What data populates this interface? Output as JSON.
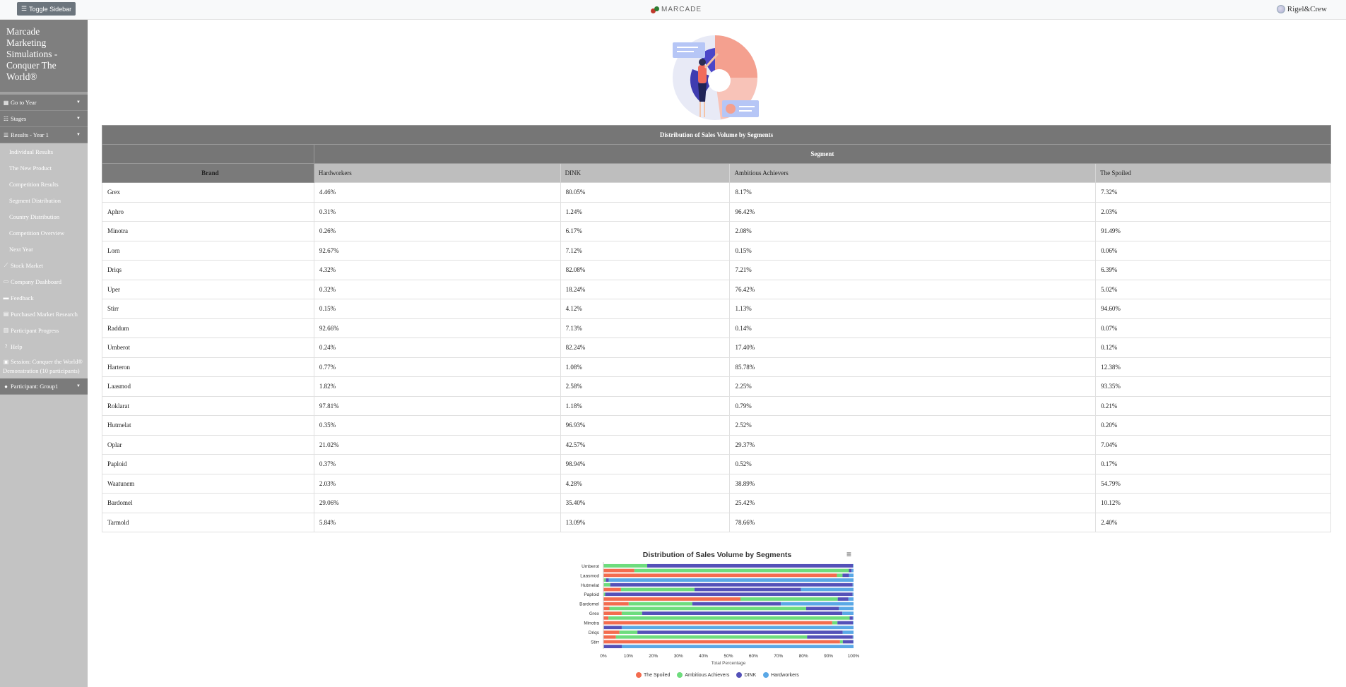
{
  "topbar": {
    "toggle_label": "Toggle Sidebar",
    "logo_text": "MARCADE",
    "company": "Rigel&Crew"
  },
  "sidebar": {
    "title": "Marcade Marketing Simulations - Conquer The World®",
    "go_to_year": "Go to Year",
    "stages": "Stages",
    "results": "Results - Year 1",
    "sub_items": [
      "Individual Results",
      "The New Product",
      "Competition Results",
      "Segment Distribution",
      "Country Distribution",
      "Competition Overview",
      "Next Year"
    ],
    "stock_market": "Stock Market",
    "company_dashboard": "Company Dashboard",
    "feedback": "Feedback",
    "purchased_research": "Purchased Market Research",
    "participant_progress": "Participant Progress",
    "help": "Help",
    "session": "Session: Conquer the World® Demonstration (10 participants)",
    "participant": "Participant: Group1"
  },
  "table": {
    "caption": "Distribution of Sales Volume by Segments",
    "segment_header": "Segment",
    "brand_header": "Brand",
    "columns": [
      "Hardworkers",
      "DINK",
      "Ambitious Achievers",
      "The Spoiled"
    ],
    "rows": [
      [
        "Grex",
        "4.46%",
        "80.05%",
        "8.17%",
        "7.32%"
      ],
      [
        "Aphro",
        "0.31%",
        "1.24%",
        "96.42%",
        "2.03%"
      ],
      [
        "Minotra",
        "0.26%",
        "6.17%",
        "2.08%",
        "91.49%"
      ],
      [
        "Lorn",
        "92.67%",
        "7.12%",
        "0.15%",
        "0.06%"
      ],
      [
        "Driqs",
        "4.32%",
        "82.08%",
        "7.21%",
        "6.39%"
      ],
      [
        "Uper",
        "0.32%",
        "18.24%",
        "76.42%",
        "5.02%"
      ],
      [
        "Stirr",
        "0.15%",
        "4.12%",
        "1.13%",
        "94.60%"
      ],
      [
        "Raddum",
        "92.66%",
        "7.13%",
        "0.14%",
        "0.07%"
      ],
      [
        "Umberot",
        "0.24%",
        "82.24%",
        "17.40%",
        "0.12%"
      ],
      [
        "Harteron",
        "0.77%",
        "1.08%",
        "85.78%",
        "12.38%"
      ],
      [
        "Laasmod",
        "1.82%",
        "2.58%",
        "2.25%",
        "93.35%"
      ],
      [
        "Roklarat",
        "97.81%",
        "1.18%",
        "0.79%",
        "0.21%"
      ],
      [
        "Hutmelat",
        "0.35%",
        "96.93%",
        "2.52%",
        "0.20%"
      ],
      [
        "Oplar",
        "21.02%",
        "42.57%",
        "29.37%",
        "7.04%"
      ],
      [
        "Paploid",
        "0.37%",
        "98.94%",
        "0.52%",
        "0.17%"
      ],
      [
        "Waatunem",
        "2.03%",
        "4.28%",
        "38.89%",
        "54.79%"
      ],
      [
        "Bardomel",
        "29.06%",
        "35.40%",
        "25.42%",
        "10.12%"
      ],
      [
        "Tarmold",
        "5.84%",
        "13.09%",
        "78.66%",
        "2.40%"
      ]
    ]
  },
  "colors": {
    "spoiled": "#f36c4f",
    "ambitious": "#6edc7d",
    "dink": "#5451b8",
    "hardworkers": "#5aa8e6"
  },
  "chart_data": {
    "type": "bar",
    "orientation": "horizontal",
    "stacking": "percent",
    "title": "Distribution of Sales Volume by Segments",
    "xlabel": "Total Percentage",
    "ylabel": "",
    "xlim": [
      0,
      100
    ],
    "x_ticks": [
      "0%",
      "10%",
      "20%",
      "30%",
      "40%",
      "50%",
      "60%",
      "70%",
      "80%",
      "90%",
      "100%"
    ],
    "y_tick_labels": [
      "Umberot",
      "Laasmod",
      "Hutmelat",
      "Paploid",
      "Bardomel",
      "Grex",
      "Minotra",
      "Driqs",
      "Stirr"
    ],
    "categories": [
      "Umberot",
      "Harteron",
      "Laasmod",
      "Roklarat",
      "Hutmelat",
      "Oplar",
      "Paploid",
      "Waatunem",
      "Bardomel",
      "Tarmold",
      "Grex",
      "Aphro",
      "Minotra",
      "Lorn",
      "Driqs",
      "Uper",
      "Stirr",
      "Raddum"
    ],
    "series": [
      {
        "name": "The Spoiled",
        "values": [
          0.12,
          12.38,
          93.35,
          0.21,
          0.2,
          7.04,
          0.17,
          54.79,
          10.12,
          2.4,
          7.32,
          2.03,
          91.49,
          0.06,
          6.39,
          5.02,
          94.6,
          0.07
        ]
      },
      {
        "name": "Ambitious Achievers",
        "values": [
          17.4,
          85.78,
          2.25,
          0.79,
          2.52,
          29.37,
          0.52,
          38.89,
          25.42,
          78.66,
          8.17,
          96.42,
          2.08,
          0.15,
          7.21,
          76.42,
          1.13,
          0.14
        ]
      },
      {
        "name": "DINK",
        "values": [
          82.24,
          1.08,
          2.58,
          1.18,
          96.93,
          42.57,
          98.94,
          4.28,
          35.4,
          13.09,
          80.05,
          1.24,
          6.17,
          7.12,
          82.08,
          18.24,
          4.12,
          7.13
        ]
      },
      {
        "name": "Hardworkers",
        "values": [
          0.24,
          0.77,
          1.82,
          97.81,
          0.35,
          21.02,
          0.37,
          2.03,
          29.06,
          5.84,
          4.46,
          0.31,
          0.26,
          92.67,
          4.32,
          0.32,
          0.15,
          92.66
        ]
      }
    ],
    "legend_position": "bottom",
    "grid": false
  }
}
